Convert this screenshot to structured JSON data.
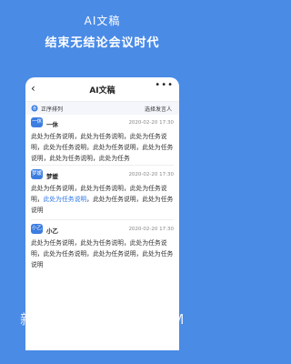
{
  "banner": {
    "title": "AI文稿",
    "subtitle": "结束无结论会议时代"
  },
  "navbar": {
    "back_icon": "back-arrow-icon",
    "title": "AI文稿",
    "more_icon": "more-dots-icon"
  },
  "filter": {
    "sort_label": "正序排列",
    "speaker_select": "选择发言人"
  },
  "entries": [
    {
      "avatar": "一休",
      "name": "一休",
      "time": "2020-02-20 17:30",
      "text": "此处为任务说明，此处为任务说明，此处为任务说明，此处为任务说明，此处为任务说明，此处为任务说明，此处为任务说明，此处为任务"
    },
    {
      "avatar": "梦媛",
      "name": "梦媛",
      "time": "2020-02-20 17:30",
      "text_before": "此处为任务说明，此处为任务说明，此处为任务说明，",
      "highlight": "此处为任务说明",
      "text_after": "，此处为任务说明，此处为任务说明"
    },
    {
      "avatar": "小乙",
      "name": "小乙",
      "time": "2020-02-20 17:30",
      "text": "此处为任务说明，此处为任务说明，此处为任务说明，此处为任务说明，此处为任务说明，此处为任务说明"
    }
  ],
  "watermark": "新意手游 • SJXINYI.COM",
  "colors": {
    "background": "#4a8be6",
    "accent": "#3b7de0",
    "highlight": "#2f77e8"
  }
}
